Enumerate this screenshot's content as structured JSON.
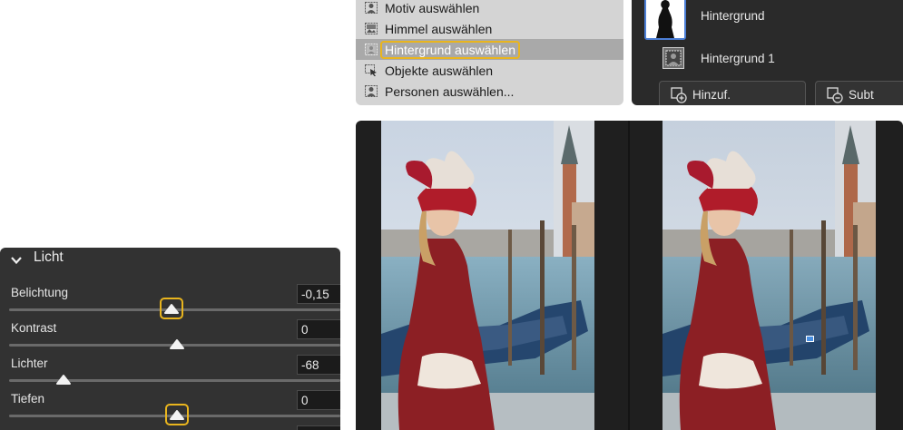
{
  "select_menu": {
    "items": [
      {
        "label": "Motiv auswählen",
        "icon": "person-select-icon",
        "selected": false
      },
      {
        "label": "Himmel auswählen",
        "icon": "sky-select-icon",
        "selected": false
      },
      {
        "label": "Hintergrund auswählen",
        "icon": "background-select-icon",
        "selected": true
      },
      {
        "label": "Objekte auswählen",
        "icon": "object-select-icon",
        "selected": false
      },
      {
        "label": "Personen auswählen...",
        "icon": "people-select-icon",
        "selected": false
      }
    ]
  },
  "layers": {
    "items": [
      {
        "label": "Hintergrund",
        "thumbnail": "silhouette-mask"
      },
      {
        "label": "Hintergrund 1",
        "thumbnail": "background-mask-icon"
      }
    ],
    "buttons": [
      {
        "label": "Hinzuf.",
        "icon": "add-mask-icon"
      },
      {
        "label": "Subt",
        "icon": "subtract-mask-icon"
      }
    ]
  },
  "licht": {
    "title": "Licht",
    "sliders": [
      {
        "label": "Belichtung",
        "value": "-0,15",
        "position": 0.5,
        "focused": true
      },
      {
        "label": "Kontrast",
        "value": "0",
        "position": 0.51,
        "focused": false
      },
      {
        "label": "Lichter",
        "value": "-68",
        "position": 0.16,
        "focused": false
      },
      {
        "label": "Tiefen",
        "value": "0",
        "position": 0.51,
        "focused": true
      }
    ]
  },
  "colors": {
    "accent_focus": "#e9b51e",
    "selection_blue": "#4c7fd6",
    "panel_dark": "#323232",
    "menu_bg": "#d4d4d4"
  }
}
